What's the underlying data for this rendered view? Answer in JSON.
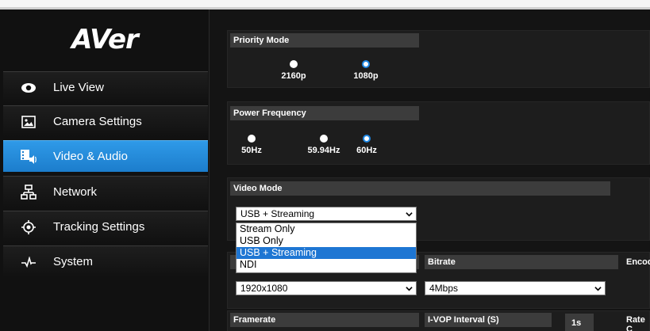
{
  "brand": {
    "logo": "AVer"
  },
  "nav": {
    "items": [
      {
        "label": "Live View",
        "icon": "eye-icon"
      },
      {
        "label": "Camera Settings",
        "icon": "image-icon"
      },
      {
        "label": "Video & Audio",
        "icon": "video-audio-icon"
      },
      {
        "label": "Network",
        "icon": "network-icon"
      },
      {
        "label": "Tracking Settings",
        "icon": "target-icon"
      },
      {
        "label": "System",
        "icon": "pulse-icon"
      }
    ],
    "active": "Video & Audio"
  },
  "priority_mode": {
    "title": "Priority Mode",
    "options": [
      "2160p",
      "1080p"
    ],
    "selected": "1080p"
  },
  "power_frequency": {
    "title": "Power Frequency",
    "options": [
      "50Hz",
      "59.94Hz",
      "60Hz"
    ],
    "selected": "60Hz"
  },
  "video_mode": {
    "title": "Video Mode",
    "value": "USB + Streaming",
    "options": [
      "Stream Only",
      "USB Only",
      "USB + Streaming",
      "NDI"
    ],
    "highlighted": "USB + Streaming"
  },
  "resolution": {
    "value": "1920x1080"
  },
  "bitrate": {
    "title": "Bitrate",
    "value": "4Mbps"
  },
  "encoding": {
    "title": "Encod"
  },
  "framerate": {
    "title": "Framerate"
  },
  "ivop": {
    "title": "I-VOP Interval (S)",
    "value": "1s"
  },
  "rate_control": {
    "title": "Rate C"
  },
  "accent": "#1e88e5"
}
